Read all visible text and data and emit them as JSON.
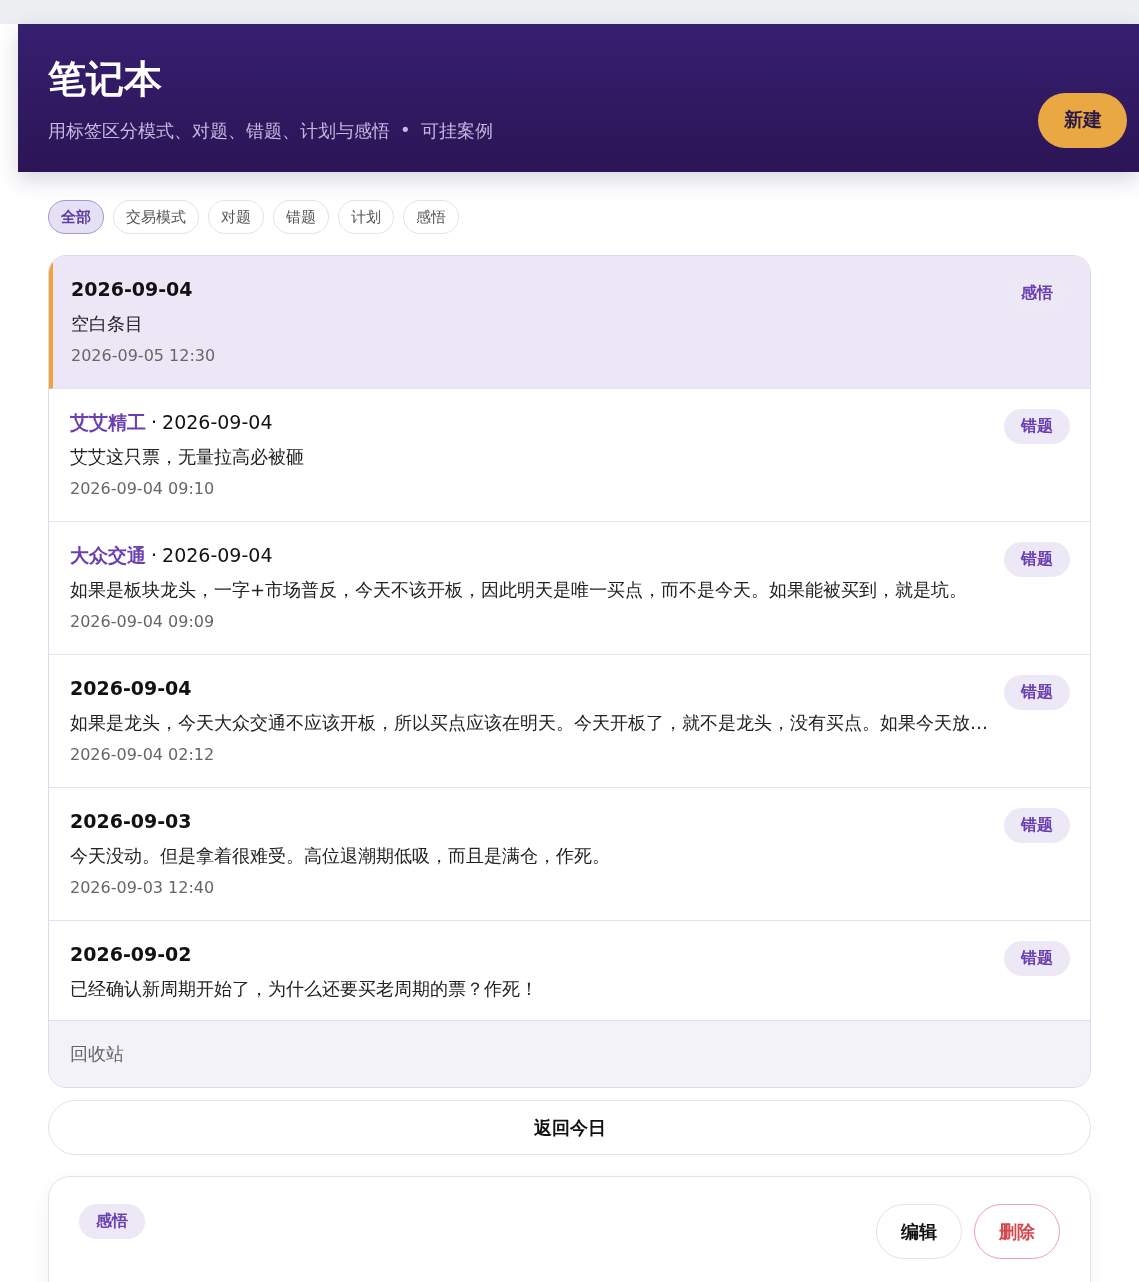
{
  "header": {
    "title": "笔记本",
    "subtitle": "用标签区分模式、对题、错题、计划与感悟",
    "separator": "•",
    "subtitle_extra": "可挂案例",
    "new_button": "新建"
  },
  "filters": [
    {
      "label": "全部",
      "selected": true
    },
    {
      "label": "交易模式",
      "selected": false
    },
    {
      "label": "对题",
      "selected": false
    },
    {
      "label": "错题",
      "selected": false
    },
    {
      "label": "计划",
      "selected": false
    },
    {
      "label": "感悟",
      "selected": false
    }
  ],
  "entries": [
    {
      "date": "2026-09-04",
      "body": "空白条目",
      "time": "2026-09-05 12:30",
      "tag": "感悟",
      "selected": true
    },
    {
      "stock": "艾艾精工",
      "separator": "·",
      "date": "2026-09-04",
      "body": "艾艾这只票，无量拉高必被砸",
      "time": "2026-09-04 09:10",
      "tag": "错题",
      "selected": false
    },
    {
      "stock": "大众交通",
      "separator": "·",
      "date": "2026-09-04",
      "body": "如果是板块龙头，一字+市场普反，今天不该开板，因此明天是唯一买点，而不是今天。如果能被买到，就是坑。",
      "time": "2026-09-04 09:09",
      "tag": "错题",
      "selected": false
    },
    {
      "date": "2026-09-04",
      "body": "如果是龙头，今天大众交通不应该开板，所以买点应该在明天。今天开板了，就不是龙头，没有买点。如果今天放…",
      "time": "2026-09-04 02:12",
      "tag": "错题",
      "selected": false
    },
    {
      "date": "2026-09-03",
      "body": "今天没动。但是拿着很难受。高位退潮期低吸，而且是满仓，作死。",
      "time": "2026-09-03 12:40",
      "tag": "错题",
      "selected": false
    },
    {
      "date": "2026-09-02",
      "body": "已经确认新周期开始了，为什么还要买老周期的票？作死！",
      "tag": "错题",
      "selected": false
    }
  ],
  "recycle_bin": "回收站",
  "back_today": "返回今日",
  "detail": {
    "tag": "感悟",
    "edit": "编辑",
    "delete": "删除"
  }
}
